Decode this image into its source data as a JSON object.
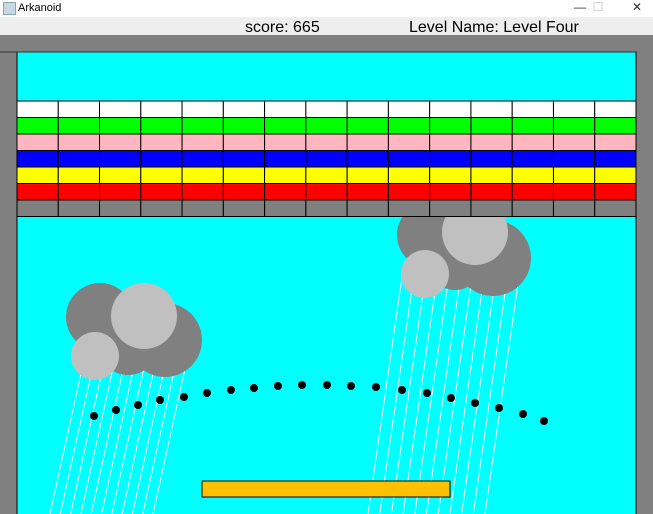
{
  "window": {
    "title": "Arkanoid",
    "minimize": "—",
    "maximize": "☐",
    "close": "✕"
  },
  "hud": {
    "score": "score: 665",
    "level": "Level Name: Level Four"
  },
  "colors": {
    "background": "#00ffff",
    "border": "#808080",
    "paddle": "#ffc000",
    "ball": "#000000",
    "cloud_dark": "#808080",
    "cloud_light": "#c0c0c0"
  },
  "bricks": {
    "columns": 15,
    "rows": [
      "#ffffff",
      "#00ff00",
      "#ffb6c1",
      "#0000ff",
      "#ffff00",
      "#ff0000",
      "#808080"
    ]
  }
}
